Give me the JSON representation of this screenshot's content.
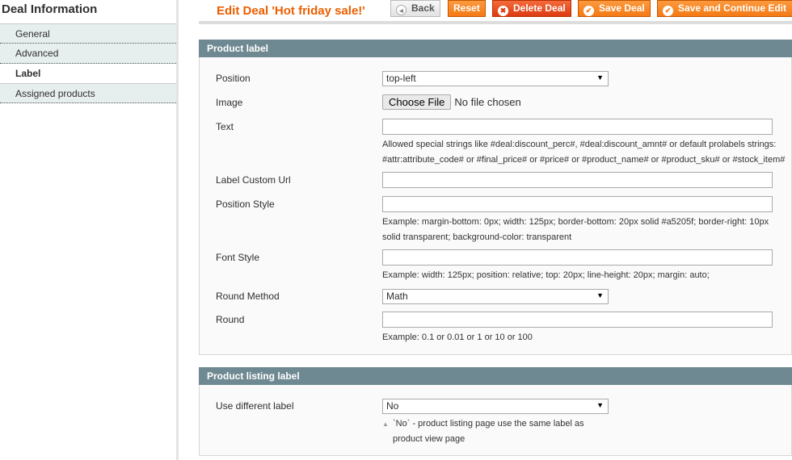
{
  "sidebar": {
    "title": "Deal Information",
    "tabs": [
      {
        "label": "General"
      },
      {
        "label": "Advanced"
      },
      {
        "label": "Label"
      },
      {
        "label": "Assigned products"
      }
    ]
  },
  "header": {
    "title": "Edit Deal 'Hot friday sale!'",
    "buttons": {
      "back": "Back",
      "reset": "Reset",
      "delete": "Delete Deal",
      "save": "Save Deal",
      "save_continue": "Save and Continue Edit"
    }
  },
  "product_label": {
    "title": "Product label",
    "position": {
      "label": "Position",
      "value": "top-left"
    },
    "image": {
      "label": "Image",
      "button": "Choose File",
      "status": "No file chosen"
    },
    "text": {
      "label": "Text",
      "value": "",
      "note": "Allowed special strings like #deal:discount_perc#, #deal:discount_amnt# or default prolabels strings: #attr:attribute_code# or #final_price# or #price# or #product_name# or #product_sku# or #stock_item#"
    },
    "custom_url": {
      "label": "Label Custom Url",
      "value": ""
    },
    "position_style": {
      "label": "Position Style",
      "value": "",
      "note": "Example: margin-bottom: 0px; width: 125px; border-bottom: 20px solid #a5205f; border-right: 10px solid transparent; background-color: transparent"
    },
    "font_style": {
      "label": "Font Style",
      "value": "",
      "note": "Example: width: 125px; position: relative; top: 20px; line-height: 20px; margin: auto;"
    },
    "round_method": {
      "label": "Round Method",
      "value": "Math"
    },
    "round": {
      "label": "Round",
      "value": "",
      "note": "Example: 0.1 or 0.01 or 1 or 10 or 100"
    }
  },
  "listing_label": {
    "title": "Product listing label",
    "use_different": {
      "label": "Use different label",
      "value": "No",
      "note": "`No` - product listing page use the same label as product view page"
    }
  }
}
